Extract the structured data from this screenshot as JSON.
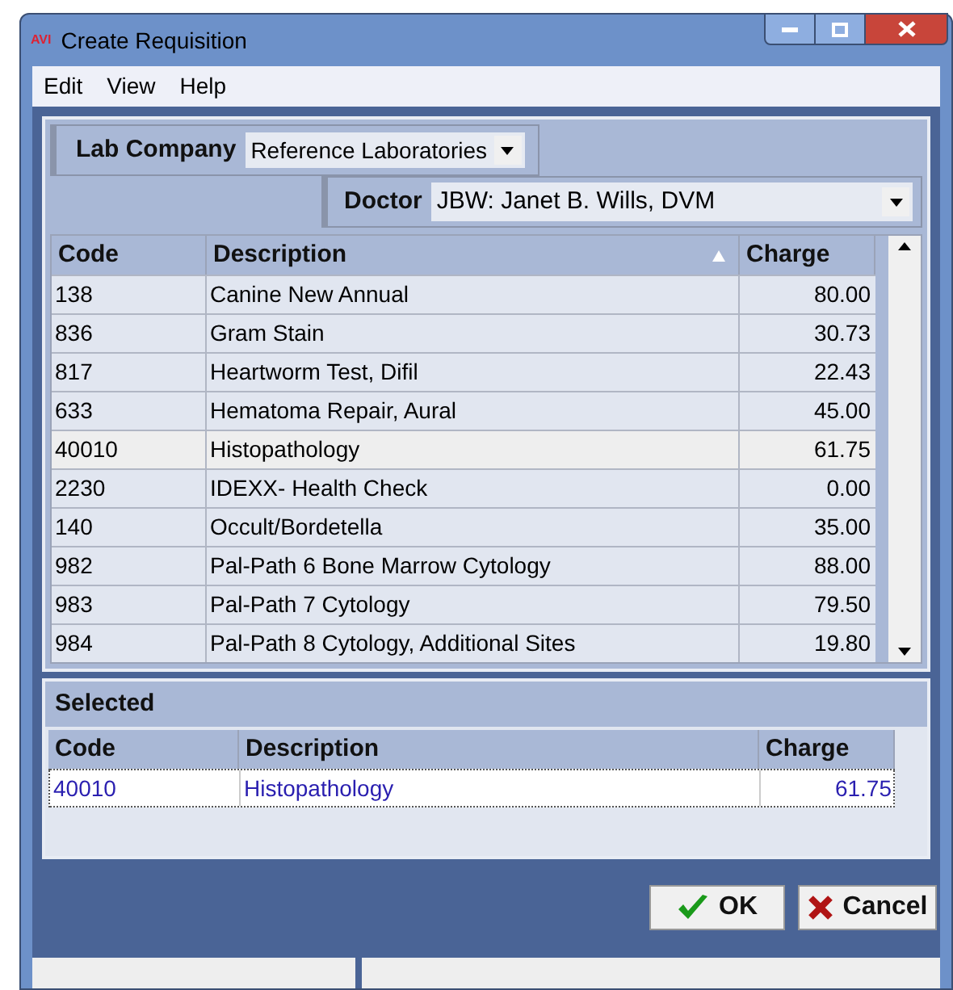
{
  "window": {
    "title": "Create Requisition",
    "logo": "AVI"
  },
  "menu": [
    "Edit",
    "View",
    "Help"
  ],
  "lab_company": {
    "label": "Lab Company",
    "value": "Reference Laboratories"
  },
  "doctor": {
    "label": "Doctor",
    "value": "JBW: Janet B. Wills, DVM"
  },
  "table": {
    "columns": [
      "Code",
      "Description",
      "Charge"
    ],
    "rows": [
      {
        "code": "138",
        "description": "Canine New Annual",
        "charge": "80.00",
        "selected": false
      },
      {
        "code": "836",
        "description": "Gram Stain",
        "charge": "30.73",
        "selected": false
      },
      {
        "code": "817",
        "description": "Heartworm Test, Difil",
        "charge": "22.43",
        "selected": false
      },
      {
        "code": "633",
        "description": "Hematoma Repair, Aural",
        "charge": "45.00",
        "selected": false
      },
      {
        "code": "40010",
        "description": "Histopathology",
        "charge": "61.75",
        "selected": true
      },
      {
        "code": "2230",
        "description": "IDEXX- Health Check",
        "charge": "0.00",
        "selected": false
      },
      {
        "code": "140",
        "description": "Occult/Bordetella",
        "charge": "35.00",
        "selected": false
      },
      {
        "code": "982",
        "description": "Pal-Path 6 Bone Marrow Cytology",
        "charge": "88.00",
        "selected": false
      },
      {
        "code": "983",
        "description": "Pal-Path 7 Cytology",
        "charge": "79.50",
        "selected": false
      },
      {
        "code": "984",
        "description": "Pal-Path 8 Cytology, Additional Sites",
        "charge": "19.80",
        "selected": false
      }
    ]
  },
  "selected_section": {
    "title": "Selected",
    "columns": [
      "Code",
      "Description",
      "Charge"
    ],
    "rows": [
      {
        "code": "40010",
        "description": "Histopathology",
        "charge": "61.75"
      }
    ]
  },
  "buttons": [
    {
      "label": "OK",
      "kind": "ok"
    },
    {
      "label": "Cancel",
      "kind": "cancel"
    }
  ]
}
